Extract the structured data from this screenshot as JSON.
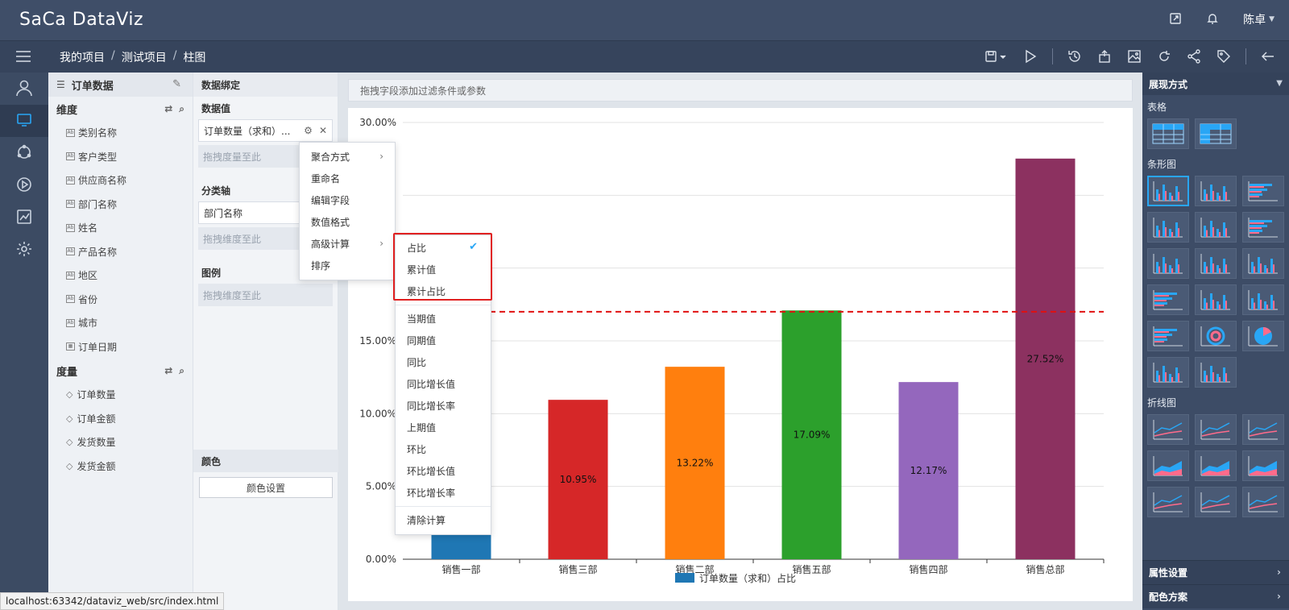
{
  "header": {
    "logo": "SaCa DataViz",
    "user": "陈卓"
  },
  "breadcrumb": [
    "我的项目",
    "测试项目",
    "柱图"
  ],
  "field_panel": {
    "title": "订单数据",
    "dimension_label": "维度",
    "dimensions": [
      "类别名称",
      "客户类型",
      "供应商名称",
      "部门名称",
      "姓名",
      "产品名称",
      "地区",
      "省份",
      "城市",
      "订单日期"
    ],
    "measure_label": "度量",
    "measures": [
      "订单数量",
      "订单金额",
      "发货数量",
      "发货金额"
    ]
  },
  "binding": {
    "title": "数据绑定",
    "value_label": "数据值",
    "value_chip": "订单数量（求和）...",
    "value_drop": "拖拽度量至此",
    "axis_label": "分类轴",
    "axis_chip": "部门名称",
    "axis_drop": "拖拽维度至此",
    "legend_label": "图例",
    "legend_drop": "拖拽维度至此",
    "color_label": "颜色",
    "color_button": "颜色设置"
  },
  "filter_placeholder": "拖拽字段添加过滤条件或参数",
  "context_menu": {
    "items": [
      "聚合方式",
      "重命名",
      "编辑字段",
      "数值格式",
      "高级计算",
      "排序"
    ]
  },
  "sub_menu": {
    "group1": [
      "占比",
      "累计值",
      "累计占比"
    ],
    "group2": [
      "当期值",
      "同期值",
      "同比",
      "同比增长值",
      "同比增长率",
      "上期值",
      "环比",
      "环比增长值",
      "环比增长率"
    ],
    "group3": [
      "清除计算"
    ],
    "checked": "占比"
  },
  "right_panel": {
    "title": "展现方式",
    "sections": [
      "表格",
      "条形图",
      "折线图"
    ],
    "footer": [
      "属性设置",
      "配色方案"
    ]
  },
  "status_url": "localhost:63342/dataviz_web/src/index.html",
  "chart_data": {
    "type": "bar",
    "categories": [
      "销售一部",
      "销售三部",
      "销售二部",
      "销售五部",
      "销售四部",
      "销售总部"
    ],
    "values": [
      19.05,
      10.95,
      13.22,
      17.09,
      12.17,
      27.52
    ],
    "labels": [
      "",
      "10.95%",
      "13.22%",
      "17.09%",
      "12.17%",
      "27.52%"
    ],
    "colors": [
      "#1f77b4",
      "#d62728",
      "#ff7f0e",
      "#2ca02c",
      "#9467bd",
      "#8c3160"
    ],
    "yticks": [
      "0.00%",
      "5.00%",
      "10.00%",
      "15.00%",
      "",
      "",
      "30.00%"
    ],
    "ylim": [
      0,
      30
    ],
    "reference_line": 17,
    "legend": "订单数量（求和）占比",
    "legend_color": "#1f77b4"
  }
}
